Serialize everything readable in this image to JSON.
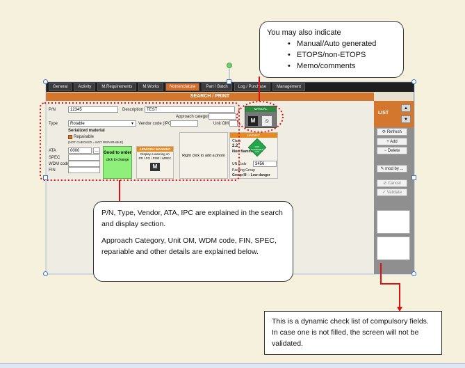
{
  "tabs": [
    {
      "label": "General",
      "active": false
    },
    {
      "label": "Activity",
      "active": false
    },
    {
      "label": "M.Requirements",
      "active": false
    },
    {
      "label": "M.Works",
      "active": false
    },
    {
      "label": "Nomenclature",
      "active": true
    },
    {
      "label": "Part / Batch",
      "active": false
    },
    {
      "label": "Log / Purchase",
      "active": false
    },
    {
      "label": "Management",
      "active": false
    }
  ],
  "window_title": "SEARCH / PRINT",
  "form": {
    "pn_label": "P/N",
    "pn_value": "12345",
    "description_label": "Description",
    "description_value": "TEST",
    "approach_label": "Approach category",
    "type_label": "Type",
    "type_value": "Rotable",
    "vendor_label": "Vendor code (IPC)",
    "unit_label": "Unit OM",
    "serialized_label": "Serialized material",
    "repairable_label": "Repairable",
    "repairable_note": "(NOT CHECKED = NOT REPAIRABLE)",
    "ata_label": "ATA",
    "ata_value": "0000",
    "spec_label": "SPEC",
    "wdm_label": "WDM code",
    "fin_label": "FIN",
    "good_order_title": "Good to order",
    "good_order_sub": "click to change",
    "airworth_title": "AIRWORH WARNING",
    "airworth_text": "Display a warning on PR / PO / POR / MREC",
    "photo_text": "Right click to add a photo",
    "manual_label": "MANUAL",
    "hazmat_header": "HAZMAT",
    "hazmat_class_label": "Class",
    "hazmat_class_value": "2.2",
    "hazmat_nonflam": "Non flammab",
    "hazmat_diamond_text": "NON FLAMMABLE GAS",
    "un_label": "UN Code",
    "un_value": "3456",
    "packing_label": "Packing Group",
    "packing_value": "Group III -- Low danger"
  },
  "sidebar": {
    "title": "LIST",
    "buttons": [
      {
        "label": "Refresh",
        "icon": "refresh-icon"
      },
      {
        "label": "Add",
        "icon": "plus-icon"
      },
      {
        "label": "Delete",
        "icon": "minus-icon"
      },
      {
        "label": "mod by ...",
        "icon": "edit-icon"
      },
      {
        "label": "Cancel",
        "icon": "cancel-icon"
      },
      {
        "label": "Validate",
        "icon": "check-icon"
      }
    ]
  },
  "callouts": {
    "top_intro": "You may also indicate",
    "top_items": [
      "Manual/Auto generated",
      "ETOPS/non-ETOPS",
      "Memo/comments"
    ],
    "middle_p1": "P/N, Type, Vendor, ATA, IPC are explained in the search and display section.",
    "middle_p2": "Approach Category, Unit OM, WDM code, FIN, SPEC, repariable and other details are explained below.",
    "bottom": "This is a dynamic check list of compulsory fields. In case one is not filled, the screen will not be validated."
  },
  "colors": {
    "accent_orange": "#d3772f",
    "annotation_red": "#e01010",
    "good_order_green": "#8ef07a",
    "hazmat_green": "#22a84a"
  }
}
